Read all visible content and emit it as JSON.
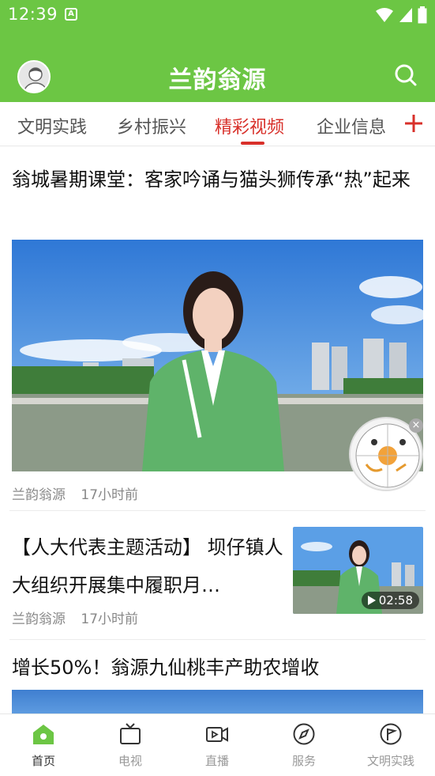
{
  "status": {
    "time": "12:39",
    "notif_icon": "A"
  },
  "header": {
    "title": "兰韵翁源"
  },
  "tabs": [
    {
      "label": "文明实践"
    },
    {
      "label": "乡村振兴"
    },
    {
      "label": "精彩视频"
    },
    {
      "label": "企业信息"
    }
  ],
  "articles": [
    {
      "title": "翁城暑期课堂：客家吟诵与猫头狮传承“热”起来",
      "source": "兰韵翁源",
      "time": "17小时前"
    },
    {
      "title": "【人大代表主题活动】 坝仔镇人大组织开展集中履职月…",
      "source": "兰韵翁源",
      "time": "17小时前",
      "duration": "02:58"
    },
    {
      "title": "增长50%！翁源九仙桃丰产助农增收"
    }
  ],
  "widget": {
    "close": "×"
  },
  "nav": [
    {
      "label": "首页",
      "icon": "home-icon"
    },
    {
      "label": "电视",
      "icon": "tv-icon"
    },
    {
      "label": "直播",
      "icon": "live-icon"
    },
    {
      "label": "服务",
      "icon": "compass-icon"
    },
    {
      "label": "文明实践",
      "icon": "flag-icon"
    }
  ],
  "colors": {
    "brand": "#6cc644",
    "accent": "#d8302a"
  }
}
